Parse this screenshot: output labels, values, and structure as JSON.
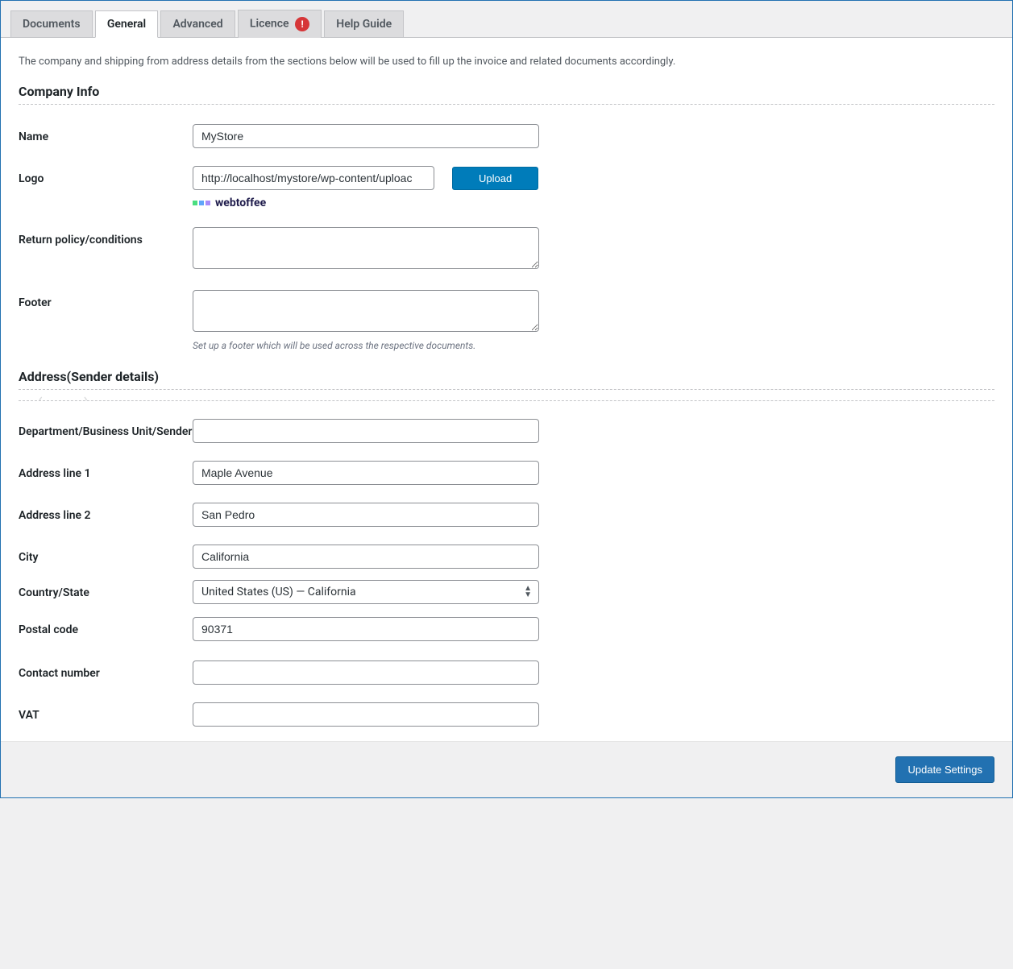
{
  "tabs": [
    {
      "label": "Documents"
    },
    {
      "label": "General"
    },
    {
      "label": "Advanced"
    },
    {
      "label": "Licence",
      "badge": "!"
    },
    {
      "label": "Help Guide"
    }
  ],
  "active_tab_index": 1,
  "intro_text": "The company and shipping from address details from the sections below will be used to fill up the invoice and related documents accordingly.",
  "sections": {
    "company": {
      "title": "Company Info",
      "name_label": "Name",
      "name_value": "MyStore",
      "logo_label": "Logo",
      "logo_value": "http://localhost/mystore/wp-content/uploac",
      "upload_button": "Upload",
      "logo_preview_brand": "webtoffee",
      "return_label": "Return policy/conditions",
      "return_value": "",
      "footer_label": "Footer",
      "footer_value": "",
      "footer_helper": "Set up a footer which will be used across the respective documents."
    },
    "address": {
      "title": "Address(Sender details)",
      "dept_label": "Department/Business Unit/Sender",
      "dept_value": "",
      "addr1_label": "Address line 1",
      "addr1_value": "Maple Avenue",
      "addr2_label": "Address line 2",
      "addr2_value": "San Pedro",
      "city_label": "City",
      "city_value": "California",
      "country_label": "Country/State",
      "country_value": "United States (US) — California",
      "postal_label": "Postal code",
      "postal_value": "90371",
      "contact_label": "Contact number",
      "contact_value": "",
      "vat_label": "VAT",
      "vat_value": ""
    }
  },
  "buttons": {
    "update": "Update Settings"
  }
}
